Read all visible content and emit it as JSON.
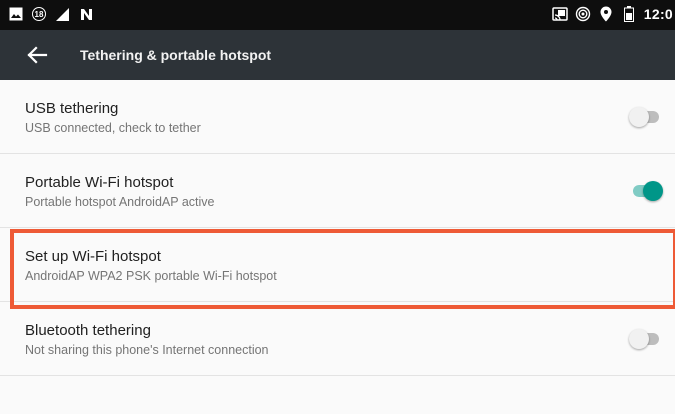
{
  "status_bar": {
    "notification_badge": "18",
    "time": "12:0",
    "icons": [
      "image-icon",
      "notification-count-icon",
      "signal-icon",
      "nfc-icon",
      "cast-icon",
      "hotspot-icon",
      "location-icon",
      "battery-icon"
    ]
  },
  "app_bar": {
    "title": "Tethering & portable hotspot",
    "back_icon": "arrow-left-icon"
  },
  "settings": [
    {
      "title": "USB tethering",
      "subtitle": "USB connected, check to tether",
      "switch": "off"
    },
    {
      "title": "Portable Wi-Fi hotspot",
      "subtitle": "Portable hotspot AndroidAP active",
      "switch": "on"
    },
    {
      "title": "Set up Wi-Fi hotspot",
      "subtitle": "AndroidAP WPA2 PSK portable Wi-Fi hotspot",
      "switch": null
    },
    {
      "title": "Bluetooth tethering",
      "subtitle": "Not sharing this phone's Internet connection",
      "switch": "off"
    }
  ],
  "colors": {
    "status_bar": "#0e0e0e",
    "app_bar": "#2d3338",
    "accent": "#009688",
    "highlight": "#ee5a36"
  }
}
